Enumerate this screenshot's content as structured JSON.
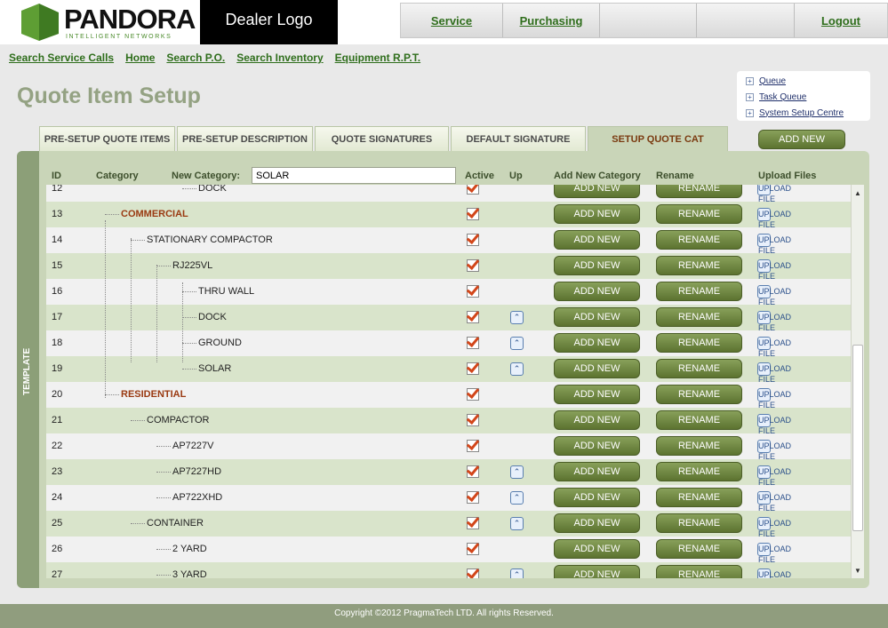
{
  "header": {
    "brand": "PANDORA",
    "brand_sub": "INTELLIGENT NETWORKS",
    "dealer_logo": "Dealer Logo",
    "nav": [
      "Service",
      "Purchasing",
      "",
      "",
      "Logout"
    ]
  },
  "links": [
    "Search Service Calls",
    "Home",
    "Search P.O.",
    "Search Inventory",
    "Equipment R.P.T."
  ],
  "page_title": "Quote Item Setup",
  "quick_links": [
    "Queue",
    "Task Queue",
    "System Setup Centre"
  ],
  "tabs": [
    "PRE-SETUP QUOTE ITEMS",
    "PRE-SETUP DESCRIPTION",
    "QUOTE SIGNATURES",
    "DEFAULT SIGNATURE",
    "SETUP QUOTE CAT"
  ],
  "add_new_top": "ADD NEW",
  "sidebar_label": "TEMPLATE",
  "columns": {
    "id": "ID",
    "category": "Category",
    "new_category": "New Category:",
    "active": "Active",
    "up": "Up",
    "add_new_category": "Add New Category",
    "rename": "Rename",
    "upload_files": "Upload Files"
  },
  "new_category_value": "SOLAR",
  "buttons": {
    "add_new": "ADD NEW",
    "rename": "RENAME",
    "upload_file": "UPLOAD FILE"
  },
  "rows": [
    {
      "id": "12",
      "label": "DOCK",
      "level": 4,
      "up": false
    },
    {
      "id": "13",
      "label": "COMMERCIAL",
      "level": 1,
      "up": false
    },
    {
      "id": "14",
      "label": "STATIONARY COMPACTOR",
      "level": 2,
      "up": false
    },
    {
      "id": "15",
      "label": "RJ225VL",
      "level": 3,
      "up": false
    },
    {
      "id": "16",
      "label": "THRU WALL",
      "level": 4,
      "up": false
    },
    {
      "id": "17",
      "label": "DOCK",
      "level": 4,
      "up": true
    },
    {
      "id": "18",
      "label": "GROUND",
      "level": 4,
      "up": true
    },
    {
      "id": "19",
      "label": "SOLAR",
      "level": 4,
      "up": true
    },
    {
      "id": "20",
      "label": "RESIDENTIAL",
      "level": 1,
      "up": false
    },
    {
      "id": "21",
      "label": "COMPACTOR",
      "level": 2,
      "up": false
    },
    {
      "id": "22",
      "label": "AP7227V",
      "level": 3,
      "up": false
    },
    {
      "id": "23",
      "label": "AP7227HD",
      "level": 3,
      "up": true
    },
    {
      "id": "24",
      "label": "AP722XHD",
      "level": 3,
      "up": true
    },
    {
      "id": "25",
      "label": "CONTAINER",
      "level": 2,
      "up": true
    },
    {
      "id": "26",
      "label": "2 YARD",
      "level": 3,
      "up": false
    },
    {
      "id": "27",
      "label": "3 YARD",
      "level": 3,
      "up": true
    }
  ],
  "footer": "Copyright ©2012 PragmaTech LTD. All rights Reserved.",
  "colors": {
    "accent_green": "#2f6e1c",
    "button_green": "#6f8640",
    "root_label": "#9a3a12"
  }
}
